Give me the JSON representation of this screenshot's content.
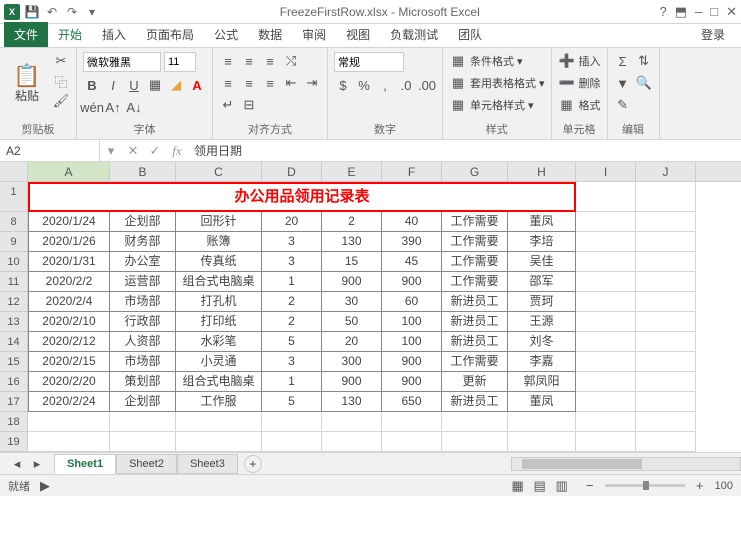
{
  "window": {
    "title": "FreezeFirstRow.xlsx - Microsoft Excel"
  },
  "tabs": {
    "file": "文件",
    "items": [
      "开始",
      "插入",
      "页面布局",
      "公式",
      "数据",
      "审阅",
      "视图",
      "负载测试",
      "团队"
    ],
    "active": 0,
    "login": "登录"
  },
  "ribbon": {
    "clipboard": {
      "label": "剪贴板",
      "paste": "粘贴"
    },
    "font": {
      "label": "字体",
      "name": "微软雅黑",
      "size": "11"
    },
    "align": {
      "label": "对齐方式"
    },
    "number": {
      "label": "数字",
      "format": "常规"
    },
    "styles": {
      "label": "样式",
      "cond": "条件格式",
      "tbl": "套用表格格式",
      "cell": "单元格样式"
    },
    "cells": {
      "label": "单元格",
      "insert": "插入",
      "delete": "删除",
      "format": "格式"
    },
    "editing": {
      "label": "编辑"
    }
  },
  "formula": {
    "namebox": "A2",
    "value": "领用日期"
  },
  "columns": [
    "A",
    "B",
    "C",
    "D",
    "E",
    "F",
    "G",
    "H",
    "I",
    "J"
  ],
  "titlerow": {
    "num": "1",
    "text": "办公用品领用记录表"
  },
  "rows": [
    {
      "n": "8",
      "c": [
        "2020/1/24",
        "企划部",
        "回形针",
        "20",
        "2",
        "40",
        "工作需要",
        "董凤"
      ]
    },
    {
      "n": "9",
      "c": [
        "2020/1/26",
        "财务部",
        "账簿",
        "3",
        "130",
        "390",
        "工作需要",
        "李培"
      ]
    },
    {
      "n": "10",
      "c": [
        "2020/1/31",
        "办公室",
        "传真纸",
        "3",
        "15",
        "45",
        "工作需要",
        "吴佳"
      ]
    },
    {
      "n": "11",
      "c": [
        "2020/2/2",
        "运营部",
        "组合式电脑桌",
        "1",
        "900",
        "900",
        "工作需要",
        "邵军"
      ]
    },
    {
      "n": "12",
      "c": [
        "2020/2/4",
        "市场部",
        "打孔机",
        "2",
        "30",
        "60",
        "新进员工",
        "贾珂"
      ]
    },
    {
      "n": "13",
      "c": [
        "2020/2/10",
        "行政部",
        "打印纸",
        "2",
        "50",
        "100",
        "新进员工",
        "王源"
      ]
    },
    {
      "n": "14",
      "c": [
        "2020/2/12",
        "人资部",
        "水彩笔",
        "5",
        "20",
        "100",
        "新进员工",
        "刘冬"
      ]
    },
    {
      "n": "15",
      "c": [
        "2020/2/15",
        "市场部",
        "小灵通",
        "3",
        "300",
        "900",
        "工作需要",
        "李嘉"
      ]
    },
    {
      "n": "16",
      "c": [
        "2020/2/20",
        "策划部",
        "组合式电脑桌",
        "1",
        "900",
        "900",
        "更新",
        "郭凤阳"
      ]
    },
    {
      "n": "17",
      "c": [
        "2020/2/24",
        "企划部",
        "工作服",
        "5",
        "130",
        "650",
        "新进员工",
        "董凤"
      ]
    }
  ],
  "emptyrows": [
    "18",
    "19"
  ],
  "sheets": {
    "items": [
      "Sheet1",
      "Sheet2",
      "Sheet3"
    ],
    "active": 0
  },
  "status": {
    "ready": "就绪",
    "zoom": "100"
  }
}
